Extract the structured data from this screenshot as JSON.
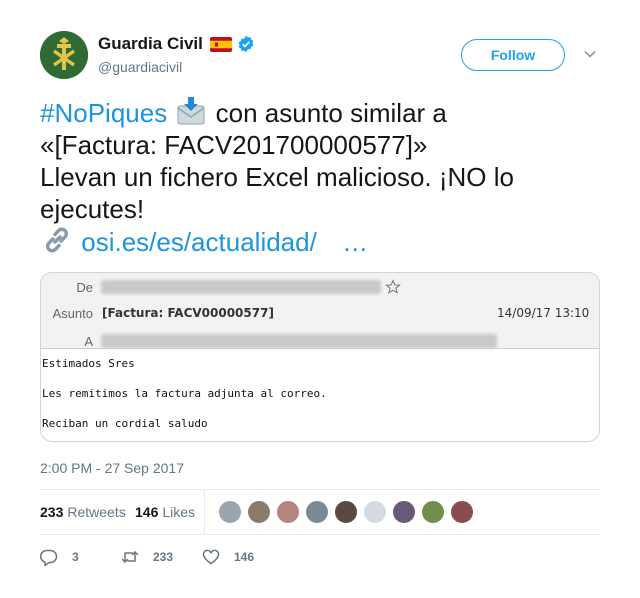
{
  "account": {
    "display_name": "Guardia Civil",
    "handle": "@guardiacivil",
    "verified": true,
    "flag_icon": "spain-flag-icon"
  },
  "follow_button": {
    "label": "Follow"
  },
  "tweet": {
    "hashtag": "#NoPiques",
    "line1_rest": " con asunto similar a",
    "line2": "«[Factura: FACV201700000577]»",
    "line3": "Llevan un fichero Excel malicioso. ¡NO lo",
    "line4": "ejecutes!",
    "link_text": "osi.es/es/actualidad/",
    "link_ellipsis": "…",
    "emoji_icon": "incoming-envelope-icon",
    "link_emoji_icon": "link-icon"
  },
  "email_screenshot": {
    "from_label": "De",
    "subject_label": "Asunto",
    "to_label": "A",
    "subject": "[Factura: FACV00000577]",
    "date": "14/09/17 13:10",
    "body": [
      "Estimados Sres",
      "Les remitimos la factura adjunta al correo.",
      "Reciban un cordial saludo"
    ]
  },
  "timestamp": "2:00 PM - 27 Sep 2017",
  "stats": {
    "retweets_count": "233",
    "retweets_label": "Retweets",
    "likes_count": "146",
    "likes_label": "Likes",
    "liker_avatar_colors": [
      "#9aa5b1",
      "#8c7b6b",
      "#b0867f",
      "#7d8a96",
      "#5b4a3f",
      "#d7dbe0",
      "#6a5a78",
      "#6f8f4a",
      "#8a4d4d"
    ]
  },
  "actions": {
    "replies": "3",
    "retweets": "233",
    "likes": "146"
  },
  "colors": {
    "accent": "#1da1f2",
    "link": "#1b95e0",
    "muted": "#657786"
  }
}
